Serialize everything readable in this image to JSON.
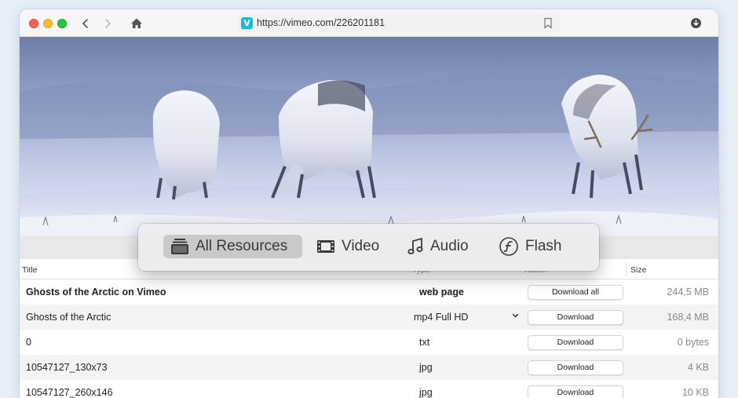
{
  "browser": {
    "url": "https://vimeo.com/226201181",
    "site_icon_letter": "V",
    "site_icon_color": "#1ab7ea"
  },
  "filter_tabs": [
    {
      "label": "All Resources",
      "icon": "stack-icon",
      "active": true
    },
    {
      "label": "Video",
      "icon": "film-icon",
      "active": false
    },
    {
      "label": "Audio",
      "icon": "music-note-icon",
      "active": false
    },
    {
      "label": "Flash",
      "icon": "flash-icon",
      "active": false
    }
  ],
  "table": {
    "headers": {
      "title": "Title",
      "type": "Type",
      "action": "Action",
      "size": "Size"
    },
    "rows": [
      {
        "title": "Ghosts of the Arctic on Vimeo",
        "type": "web page",
        "action": "Download all",
        "size": "244,5 MB",
        "bold": true
      },
      {
        "title": "Ghosts of the Arctic",
        "type": "mp4 Full HD",
        "action": "Download",
        "size": "168,4 MB",
        "dropdown": true
      },
      {
        "title": "0",
        "type": "txt",
        "action": "Download",
        "size": "0 bytes"
      },
      {
        "title": "10547127_130x73",
        "type": "jpg",
        "action": "Download",
        "size": "4 KB"
      },
      {
        "title": "10547127_260x146",
        "type": "jpg",
        "action": "Download",
        "size": "10 KB"
      }
    ]
  }
}
